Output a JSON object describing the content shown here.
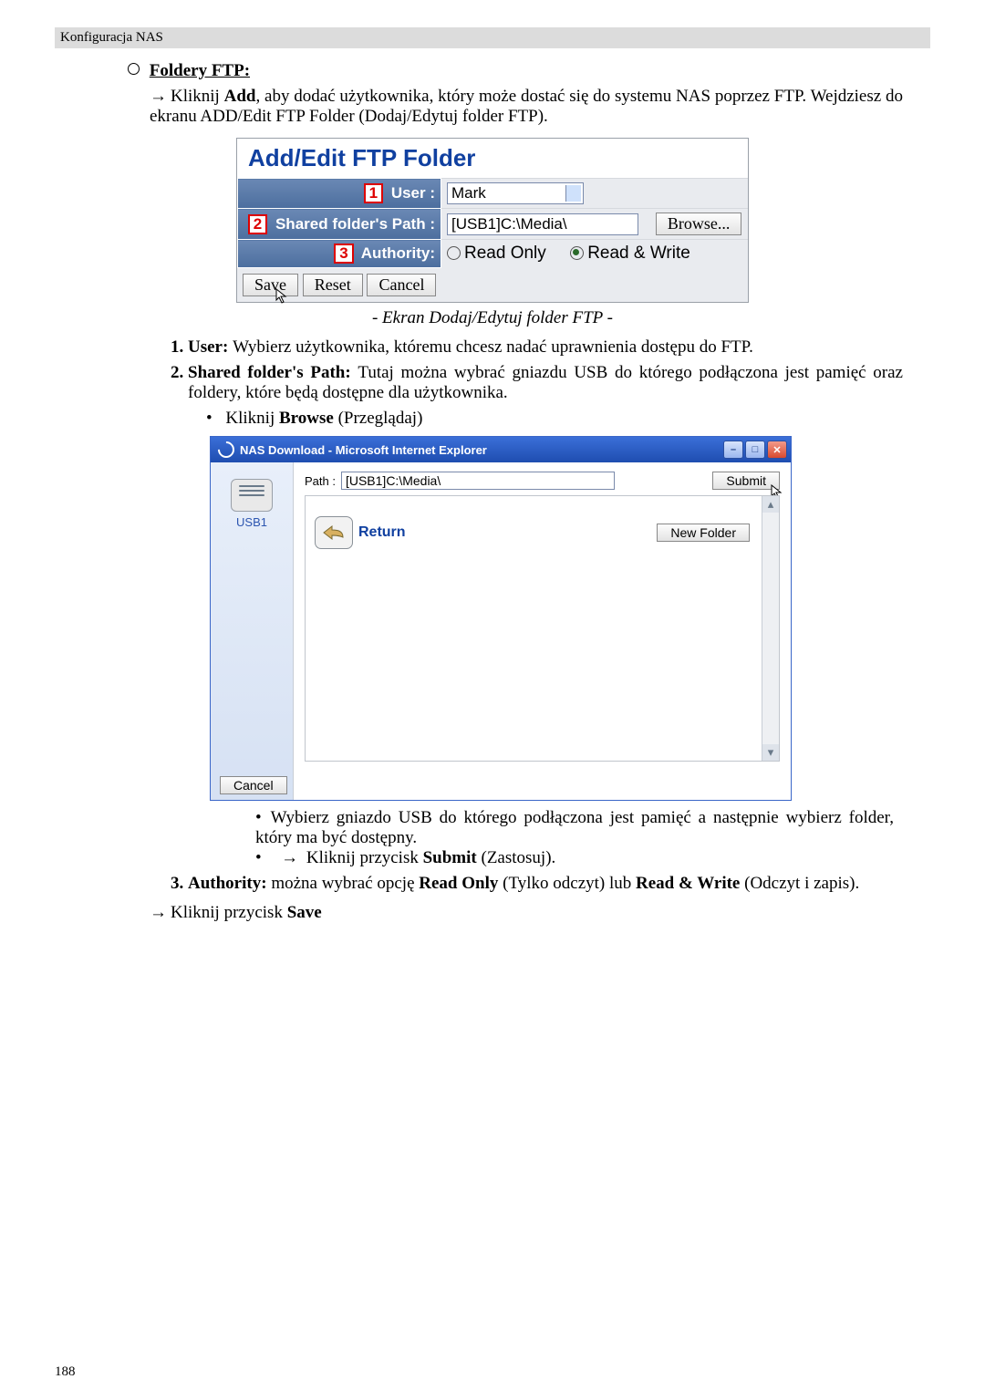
{
  "header": "Konfiguracja NAS",
  "section_title": "Foldery FTP:",
  "intro_line1_a": "Kliknij ",
  "intro_line1_b": "Add",
  "intro_line1_c": ", aby dodać użytkownika, który może dostać się do systemu NAS poprzez FTP. Wejdziesz do ekranu ADD/Edit FTP Folder (Dodaj/Edytuj folder FTP).",
  "fig1": {
    "title": "Add/Edit FTP Folder",
    "n1": "1",
    "n2": "2",
    "n3": "3",
    "user_label": "User :",
    "user_value": "Mark",
    "path_label": "Shared folder's Path :",
    "path_value": "[USB1]C:\\Media\\",
    "browse": "Browse...",
    "authority_label": "Authority:",
    "readonly": "Read Only",
    "readwrite": "Read & Write",
    "save": "Save",
    "reset": "Reset",
    "cancel": "Cancel"
  },
  "caption1": "- Ekran Dodaj/Edytuj folder FTP -",
  "items": {
    "i1_a": "User: ",
    "i1_b": "Wybierz użytkownika, któremu chcesz nadać uprawnienia dostępu do FTP.",
    "i2_a": "Shared folder's Path: ",
    "i2_b": "Tutaj można wybrać gniazdu USB do którego podłączona jest pamięć oraz foldery, które będą dostępne dla użytkownika.",
    "i2_bullet_a": "Kliknij ",
    "i2_bullet_b": "Browse",
    "i2_bullet_c": " (Przeglądaj)",
    "i2_post1": "Wybierz gniazdo USB do którego podłączona jest pamięć a następnie wybierz folder, który ma być dostępny.",
    "i2_post2_a": "Kliknij przycisk ",
    "i2_post2_b": "Submit",
    "i2_post2_c": " (Zastosuj).",
    "i3_a": "Authority: ",
    "i3_b": "można wybrać opcję ",
    "i3_c": "Read Only",
    "i3_d": " (Tylko odczyt) lub ",
    "i3_e": "Read & Write",
    "i3_f": " (Odczyt i zapis)."
  },
  "fig2": {
    "title": "NAS Download - Microsoft Internet Explorer",
    "path_label": "Path :",
    "path_value": "[USB1]C:\\Media\\",
    "submit": "Submit",
    "usb_label": "USB1",
    "return": "Return",
    "newfolder": "New Folder",
    "cancel": "Cancel"
  },
  "final_a": "Kliknij przycisk ",
  "final_b": "Save",
  "pagenum": "188"
}
